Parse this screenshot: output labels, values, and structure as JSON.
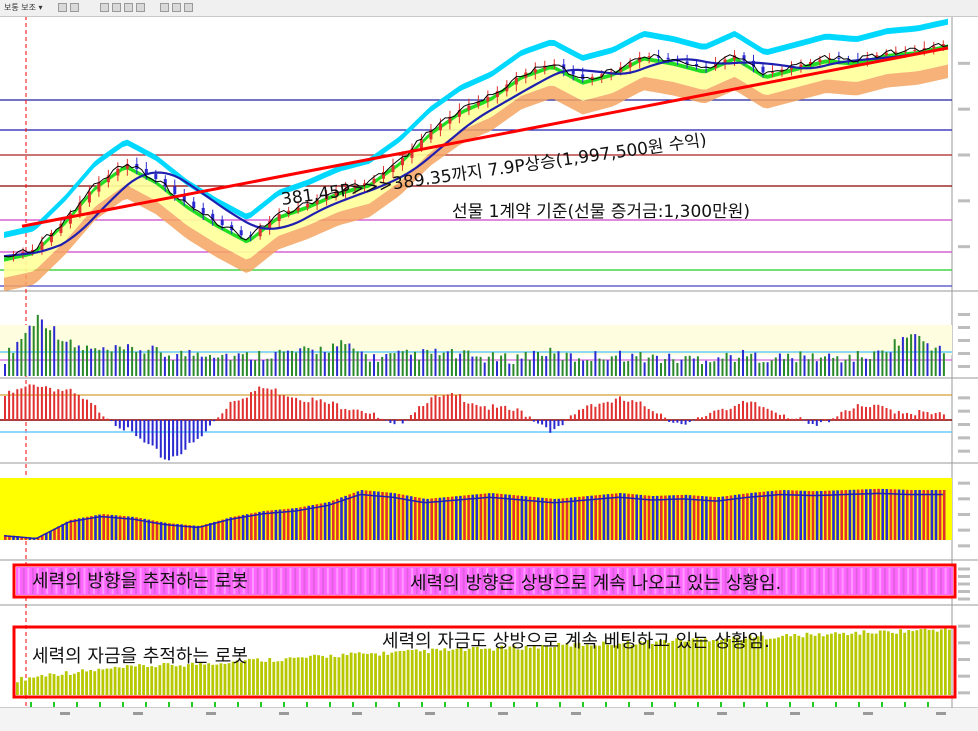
{
  "toolbar": {
    "label_a": "보통 보조 ▾",
    "label_b": ""
  },
  "annotations": {
    "trend_text": "381.45P>>>389.35까지 7.9P상승(1,997,500원 수익)",
    "contract_text": "선물 1계약 기준(선물 증거금:1,300만원)",
    "direction_robot": "세력의 방향을 추적하는 로봇",
    "direction_status": "세력의 방향은 상방으로 계속 나오고 있는 상황임.",
    "fund_robot": "세력의 자금을 추적하는 로봇",
    "fund_status": "세력의 자금도 상방으로 계속 베팅하고 있는 상황임."
  },
  "colors": {
    "trendline": "#ff0000",
    "box_border": "#ff0000",
    "price_line": "#000000",
    "ma_line": "#1f1fb0",
    "cloud_top": "#00d8ff",
    "band_green": "#22dd22",
    "band_yellow": "#ffff99",
    "band_orange": "#f4a460",
    "up_bar": "#e03030",
    "down_bar": "#2a2ad0",
    "magenta_bg": "#ff66ff",
    "olive_bar": "#b8c800",
    "yellow_fill": "#ffff00",
    "vline": "#ff0000"
  },
  "chart_data": [
    {
      "type": "line",
      "panel": "price",
      "series": [
        {
          "values": [
            381.45,
            381.7,
            382.8,
            384.1,
            384.9,
            384.3,
            383.4,
            382.7,
            382.1,
            383.0,
            383.4,
            383.9,
            384.2,
            385.0,
            386.1,
            386.9,
            387.4,
            388.2,
            388.6,
            388.0,
            388.3,
            388.9,
            388.7,
            388.4,
            388.9,
            388.2,
            388.5,
            388.8,
            388.7,
            389.0,
            389.1,
            389.35
          ]
        }
      ],
      "trendline": {
        "from": 381.45,
        "to": 389.35
      }
    },
    {
      "type": "bar",
      "panel": "volume-histogram",
      "values": [
        0.2,
        0.9,
        0.4,
        0.3,
        0.35,
        0.25,
        0.3,
        0.22,
        0.28,
        0.3,
        0.42,
        0.2,
        0.25,
        0.28,
        0.22,
        0.18,
        0.3,
        0.2,
        0.25,
        0.22,
        0.18,
        0.2,
        0.24,
        0.2,
        0.22,
        0.2,
        0.25,
        0.6,
        0.3
      ]
    },
    {
      "type": "bar",
      "panel": "oscillator",
      "values": [
        0.6,
        0.9,
        0.7,
        0.2,
        -0.4,
        -1.0,
        -0.5,
        0.5,
        0.8,
        0.6,
        0.4,
        0.3,
        -0.2,
        0.5,
        0.6,
        0.3,
        0.2,
        -0.3,
        0.4,
        0.5,
        0.3,
        -0.2,
        0.3,
        0.4,
        0.2,
        -0.2,
        0.3,
        0.3,
        0.2,
        0.1
      ]
    },
    {
      "type": "bar",
      "panel": "direction-robot",
      "values": [
        0.15,
        0.1,
        0.4,
        0.5,
        0.45,
        0.35,
        0.3,
        0.45,
        0.55,
        0.6,
        0.7,
        0.9,
        0.85,
        0.75,
        0.8,
        0.85,
        0.8,
        0.75,
        0.8,
        0.85,
        0.8,
        0.82,
        0.78,
        0.85,
        0.9,
        0.88,
        0.9,
        0.92,
        0.9,
        0.9
      ]
    },
    {
      "type": "bar",
      "panel": "fund-robot",
      "values": [
        0.05,
        0.15,
        0.2,
        0.25,
        0.3,
        0.32,
        0.35,
        0.4,
        0.42,
        0.45,
        0.5,
        0.52,
        0.55,
        0.58,
        0.6,
        0.62,
        0.65,
        0.68,
        0.7,
        0.72,
        0.75,
        0.78,
        0.8,
        0.82,
        0.85,
        0.87,
        0.9,
        0.92,
        0.95,
        0.97
      ]
    }
  ]
}
